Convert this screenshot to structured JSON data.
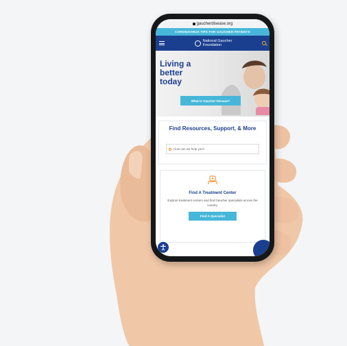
{
  "browser": {
    "url": "gaucherdisease.org"
  },
  "alert_bar": {
    "text": "CORONAVIRUS TIPS FOR GAUCHER PATIENTS"
  },
  "nav": {
    "brand_line1": "National Gaucher",
    "brand_line2": "Foundation"
  },
  "hero": {
    "title_line1": "Living a",
    "title_line2": "better",
    "title_line3": "today",
    "button_label": "What is Gaucher Disease?"
  },
  "resources": {
    "title": "Find Resources, Support, & More",
    "search_placeholder": "How can we help you?"
  },
  "treatment": {
    "title": "Find A Treatment Center",
    "description": "Explore treatment centers and find Gaucher specialists across the country.",
    "button_label": "Find A Specialist"
  },
  "colors": {
    "brand_blue": "#1b3f8f",
    "accent_cyan": "#47b7d9",
    "search_orange": "#f08a20"
  }
}
